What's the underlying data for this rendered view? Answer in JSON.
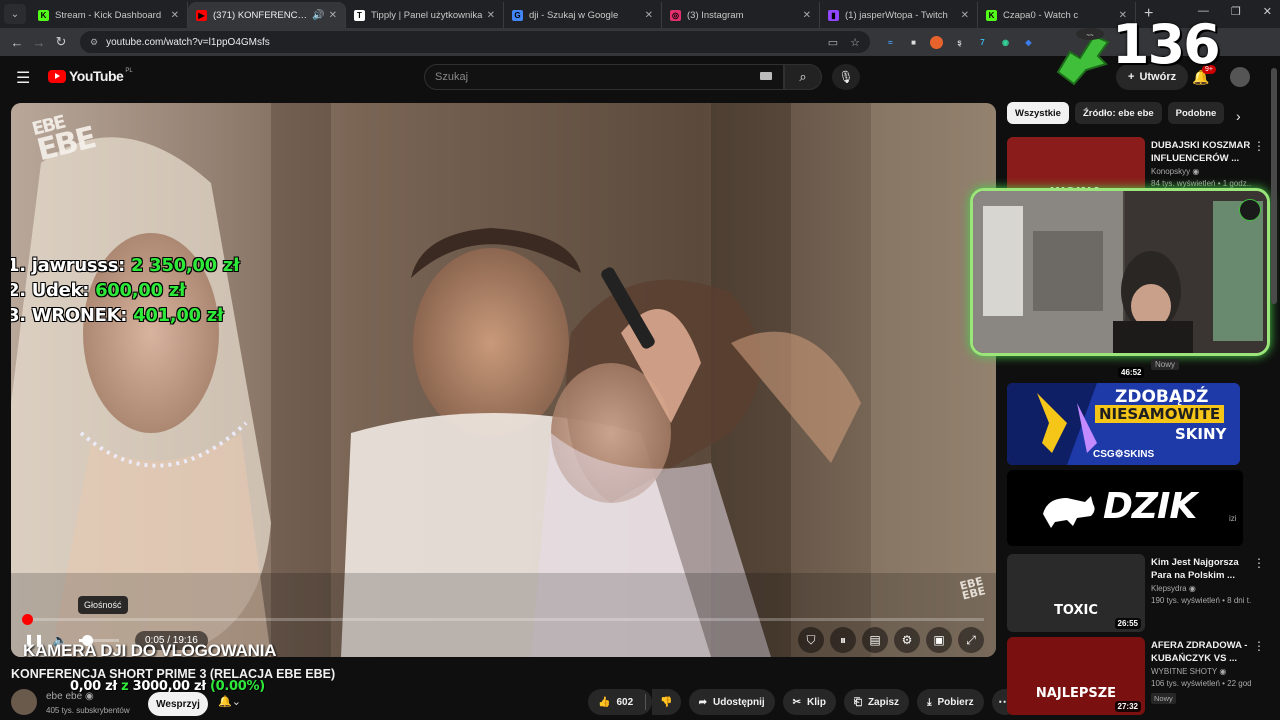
{
  "browser": {
    "tabs": [
      {
        "title": "Stream - Kick Dashboard",
        "fav_color": "#53fc18",
        "fav_glyph": "K",
        "active": false
      },
      {
        "title": "(371) KONFERENCJA SHORT PRIME 3",
        "fav_color": "#ff0000",
        "fav_glyph": "▶",
        "active": true
      },
      {
        "title": "Tipply | Panel użytkownika",
        "fav_color": "#ffffff",
        "fav_glyph": "T",
        "active": false
      },
      {
        "title": "dji - Szukaj w Google",
        "fav_color": "#4285f4",
        "fav_glyph": "G",
        "active": false
      },
      {
        "title": "(3) Instagram",
        "fav_color": "#e1306c",
        "fav_glyph": "◎",
        "active": false
      },
      {
        "title": "(1) jasperWtopa - Twitch",
        "fav_color": "#9146ff",
        "fav_glyph": "▮",
        "active": false
      },
      {
        "title": "Czapa0 - Watch c",
        "fav_color": "#53fc18",
        "fav_glyph": "K",
        "active": false
      }
    ],
    "url": "youtube.com/watch?v=l1ppO4GMsfs"
  },
  "overlay": {
    "counter": "136",
    "donors": [
      {
        "label": "1. jawrusss:",
        "amount": "2 350,00 zł"
      },
      {
        "label": "2. Udek:",
        "amount": "600,00 zł"
      },
      {
        "label": "3. WRONEK:",
        "amount": "401,00 zł"
      }
    ],
    "goal_prefix": "0,00 zł",
    "goal_z": "z",
    "goal_target": "3000,00 zł",
    "goal_pct": "(0.00%)",
    "ebe_top": "EBE",
    "ebe_bottom": "EBE",
    "ebe_watermark_top": "EBE",
    "ebe_watermark_bottom": "EBE"
  },
  "youtube": {
    "logo_text": "YouTube",
    "country": "PL",
    "search_placeholder": "Szukaj",
    "create_label": "Utwórz",
    "notif_badge": "9+",
    "player": {
      "tooltip": "Głośność",
      "time": "0:05 / 19:16",
      "progress_fraction": 0.004,
      "volume_fraction": 0.2,
      "chapter_title": "KAMERA DJI DO VLOGOWANIA"
    },
    "video_title": "KONFERENCJA SHORT PRIME 3 (RELACJA EBE EBE)",
    "channel_name": "ebe ebe",
    "subscribers": "405 tys. subskrybentów",
    "subscribe_label": "Wesprzyj",
    "actions": {
      "likes": "602",
      "share": "Udostępnij",
      "clip": "Klip",
      "save": "Zapisz",
      "download": "Pobierz"
    },
    "chips": [
      "Wszystkie",
      "Źródło: ebe ebe",
      "Podobne"
    ],
    "recommendations": [
      {
        "title": "DUBAJSKI KOSZMAR INFLUENCERÓW ...",
        "channel": "Konopskyy",
        "meta": "84 tys. wyświetleń • 1 godz...",
        "duration": "",
        "new": "",
        "thumb": "#8b1c1c",
        "thumb_text": "WOJNA"
      },
      {
        "title": "Kim Jest Najgorsza Para na Polskim ...",
        "channel": "Klepsydra",
        "meta": "190 tys. wyświetleń • 8 dni t...",
        "duration": "26:55",
        "new": "",
        "thumb": "#2a2a2a",
        "thumb_text": "TOXIC"
      },
      {
        "title": "AFERA ZDRADOWA - KUBAŃCZYK VS ...",
        "channel": "WYBITNE SHOTY",
        "meta": "106 tys. wyświetleń • 22 god...",
        "duration": "27:32",
        "new": "Nowy",
        "thumb": "#7a1010",
        "thumb_text": "NAJLEPSZE"
      }
    ],
    "webcam_new": "Nowy",
    "webcam_duration": "46:52",
    "ad_skins": {
      "line1": "ZDOBĄDŹ",
      "line2": "NIESAMOWITE",
      "line3": "SKINY",
      "brand": "CSG⚙SKINS"
    },
    "ad_dzik": {
      "brand": "DZIK",
      "suffix": "izi"
    }
  },
  "colors": {
    "accent_green": "#2ee93a",
    "yt_red": "#ff0000",
    "webcam_border": "#9be57a"
  }
}
